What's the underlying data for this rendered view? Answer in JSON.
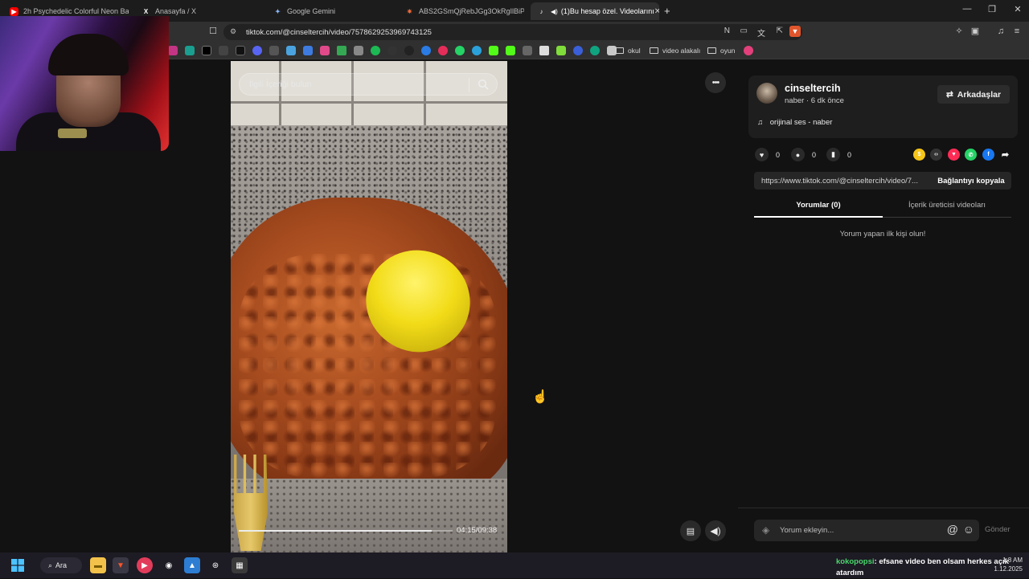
{
  "tabs": [
    {
      "title": "2h Psychedelic Colorful Neon Backg",
      "icon": "youtube-icon"
    },
    {
      "title": "Anasayfa / X",
      "icon": "x-icon"
    },
    {
      "title": "Google Gemini",
      "icon": "gemini-icon"
    },
    {
      "title": "ABS2GSmQjRebJGg3OkRgIlBiPG9Wi",
      "icon": "app-icon"
    },
    {
      "title": "(1)Bu hesap özel. Videolarını",
      "icon": "tiktok-icon",
      "active": true
    }
  ],
  "new_tab_label": "+",
  "window_controls": {
    "minimize": "—",
    "restore": "❐",
    "close": "✕"
  },
  "address": {
    "url": "tiktok.com/@cinseltercih/video/7578629253969743125"
  },
  "bookmarks": {
    "folders": [
      "okul",
      "video alakalı",
      "oyun"
    ]
  },
  "video": {
    "search_placeholder": "İlgili İçeriği bulun",
    "time": "04:15/09:38",
    "progress_fraction": 0.9
  },
  "more_button_label": "•••",
  "panel": {
    "author": "cinseltercih",
    "subline": "naber · 6 dk önce",
    "friends_button": "Arkadaşlar",
    "friends_icon": "⇄",
    "music": "orijinal ses - naber",
    "likes": "0",
    "comments": "0",
    "saves": "0",
    "link": "https://www.tiktok.com/@cinseltercih/video/7...",
    "copy_link": "Bağlantıyı kopyala",
    "tab_comments": "Yorumlar (0)",
    "tab_creator": "İçerik üreticisi videoları",
    "empty_text": "Yorum yapan ilk kişi olun!",
    "comment_placeholder": "Yorum ekleyin...",
    "send": "Gönder"
  },
  "taskbar": {
    "search_label": "Ara",
    "chat_user": "kokopopsi",
    "chat_message": ": efsane video ben olsam herkes açık atardım",
    "time": "1:8 AM",
    "date": "1.12.2025"
  },
  "colors": {
    "accent_red": "#fe2c55",
    "chat_user": "#49d86d"
  }
}
